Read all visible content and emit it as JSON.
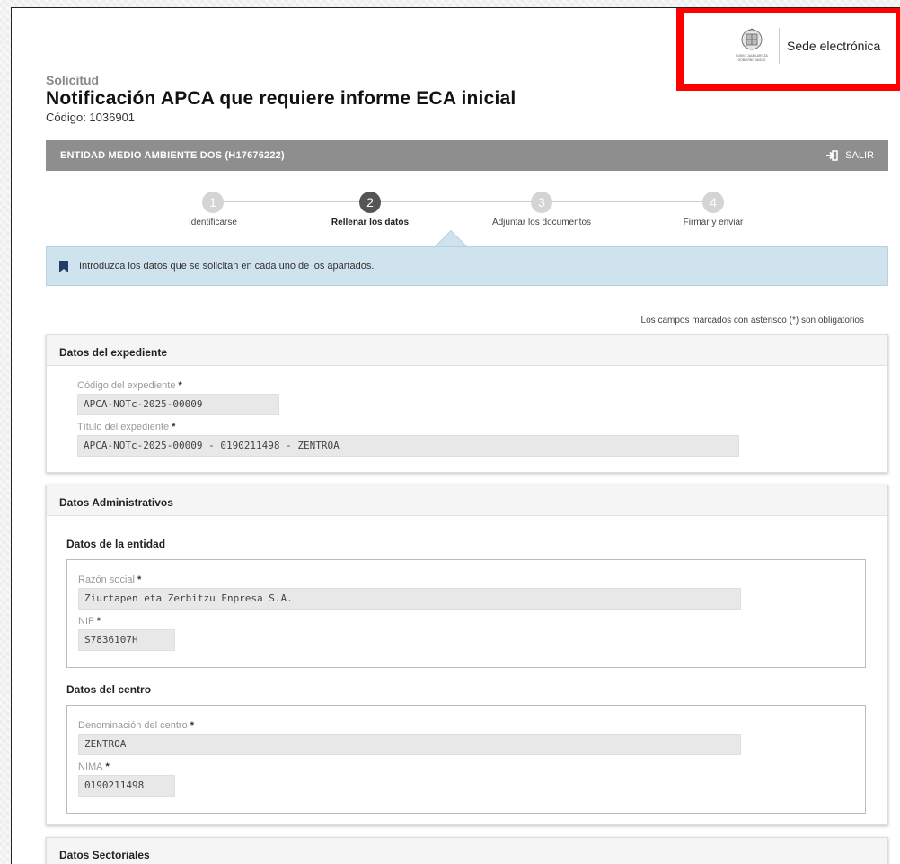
{
  "sede": {
    "label": "Sede electrónica",
    "seal_caption_1": "EUSKO JAURLARITZA",
    "seal_caption_2": "GOBIERNO VASCO"
  },
  "header": {
    "kicker": "Solicitud",
    "title": "Notificación APCA que requiere informe ECA inicial",
    "code": "Código: 1036901"
  },
  "entity_bar": {
    "name": "ENTIDAD MEDIO AMBIENTE DOS (H17676222)",
    "logout_label": "SALIR"
  },
  "steps": [
    {
      "number": "1",
      "label": "Identificarse"
    },
    {
      "number": "2",
      "label": "Rellenar los datos"
    },
    {
      "number": "3",
      "label": "Adjuntar los documentos"
    },
    {
      "number": "4",
      "label": "Firmar y enviar"
    }
  ],
  "active_step": 2,
  "info_message": "Introduzca los datos que se solicitan en cada uno de los apartados.",
  "required_note": "Los campos marcados con asterisco (*) son obligatorios",
  "sections": {
    "expediente": {
      "title": "Datos del expediente",
      "codigo_label": "Código del expediente",
      "codigo_value": "APCA-NOTc-2025-00009",
      "titulo_label": "Título del expediente",
      "titulo_value": "APCA-NOTc-2025-00009 - 0190211498 - ZENTROA"
    },
    "administrativos": {
      "title": "Datos Administrativos",
      "entidad": {
        "title": "Datos de la entidad",
        "razon_label": "Razón social",
        "razon_value": "Ziurtapen eta Zerbitzu Enpresa S.A.",
        "nif_label": "NIF",
        "nif_value": "S7836107H"
      },
      "centro": {
        "title": "Datos del centro",
        "denominacion_label": "Denominación del centro",
        "denominacion_value": "ZENTROA",
        "nima_label": "NIMA",
        "nima_value": "0190211498"
      }
    },
    "sectoriales": {
      "title": "Datos Sectoriales"
    }
  },
  "required_marker": "*",
  "colors": {
    "entity_bar": "#8e8e8e",
    "info_bg": "#cfe3ee",
    "highlight": "#ff0000",
    "active_step": "#555555"
  }
}
